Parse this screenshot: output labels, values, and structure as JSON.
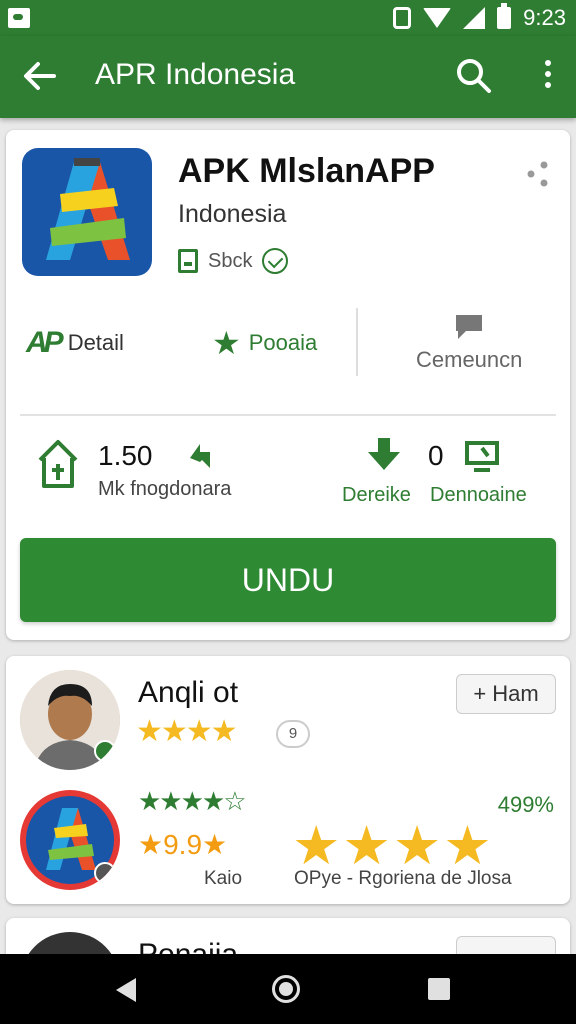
{
  "status_bar": {
    "time": "9:23"
  },
  "app_bar": {
    "title": "APR Indonesia"
  },
  "app": {
    "name": "APK MlslanAPP",
    "subtitle": "Indonesia",
    "badge_text": "Sbck"
  },
  "tabs": {
    "detail_logo": "AP",
    "detail": "Detail",
    "popular": "Pooaia",
    "comment": "Cemeuncn"
  },
  "stats": {
    "rating_value": "1.50",
    "rating_label": "Mk fnogdonara",
    "download_value": "0",
    "download_label": "Dereike",
    "screens_label": "Dennoaine"
  },
  "install_button": "UNDU",
  "review": {
    "name": "Anqli ot",
    "stars": "★★★★",
    "count_pill": "9",
    "follow_label": "Ham",
    "stars_green": "★★★★☆",
    "percent": "499%",
    "score": "★9.9★",
    "big_stars": "★★★★",
    "label_left": "Kaio",
    "label_right": "OPye - Rgoriena de Jlosa"
  },
  "next_review": {
    "name": "Ponaiia"
  },
  "colors": {
    "primary": "#2e7d32",
    "star": "#f5b921"
  }
}
